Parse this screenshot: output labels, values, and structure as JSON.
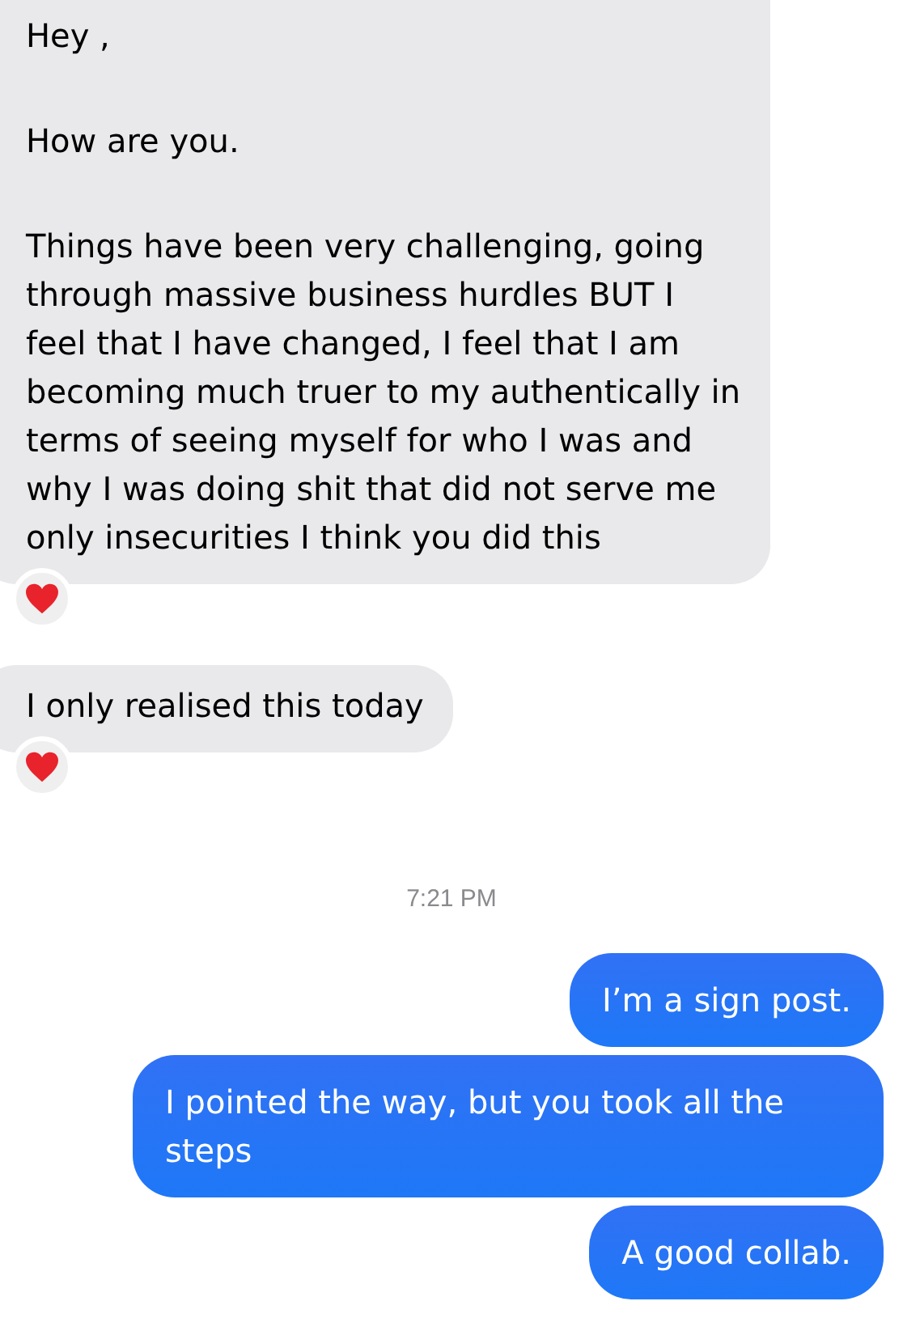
{
  "messages": [
    {
      "kind": "incoming",
      "paragraphs": [
        "Hey ,",
        "How are you.",
        "Things have been very challenging, going through massive business hurdles BUT I feel that I have changed, I feel that I am becoming much truer to my authentically in terms of seeing myself for who I was and why I was doing shit that did not serve me only insecurities I think you did this"
      ],
      "reacted": true
    },
    {
      "kind": "incoming",
      "paragraphs": [
        "I only realised this today"
      ],
      "reacted": true
    },
    {
      "kind": "time",
      "text": "7:21 PM"
    },
    {
      "kind": "outgoing",
      "paragraphs": [
        "I’m a sign post."
      ]
    },
    {
      "kind": "outgoing",
      "paragraphs": [
        "I pointed the way, but you took all the steps"
      ]
    },
    {
      "kind": "outgoing",
      "paragraphs": [
        "A good collab."
      ]
    }
  ]
}
